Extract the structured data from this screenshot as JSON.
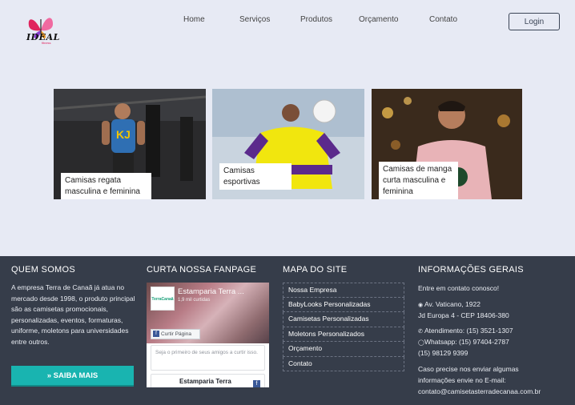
{
  "header": {
    "logo_text": "IDEAL",
    "logo_sub": "fitness",
    "nav": [
      "Home",
      "Serviços",
      "Produtos",
      "Orçamento",
      "Contato"
    ],
    "login_label": "Login"
  },
  "cards": [
    {
      "caption": "Camisas regata masculina e feminina"
    },
    {
      "caption": "Camisas esportivas"
    },
    {
      "caption": "Camisas de manga curta masculina e feminina"
    }
  ],
  "footer": {
    "about": {
      "title": "QUEM SOMOS",
      "text": "A empresa Terra de Canaã já atua no mercado desde 1998, o produto principal são as camisetas promocionais, personalizadas, eventos, formaturas, uniforme, moletons para universidades entre outros.",
      "button_label": "» SAIBA MAIS"
    },
    "fanpage": {
      "title": "CURTA NOSSA FANPAGE",
      "page_name": "Estamparia Terra ...",
      "likes": "1,9 mil curtidas",
      "like_button": "Curtir Página",
      "avatar_text": "TerraCanaã",
      "post_text": "Seja o primeiro de seus amigos a curtir isso.",
      "post2_name": "Estamparia Terra"
    },
    "sitemap": {
      "title": "MAPA DO SITE",
      "items": [
        "Nossa Empresa",
        "BabyLooks Personalizadas",
        "Camisetas Personalizadas",
        "Moletons Personalizados",
        "Orçamento",
        "Contato"
      ]
    },
    "info": {
      "title": "INFORMAÇÕES GERAIS",
      "intro": "Entre em contato conosco!",
      "address1": "Av. Vaticano, 1922",
      "address2": "Jd Europa 4 - CEP 18406-380",
      "phone": "Atendimento: (15) 3521-1307",
      "whatsapp": "Whatsapp: (15) 97404-2787",
      "phone2": "(15) 98129 9399",
      "email_note1": "Caso precise nos enviar algumas",
      "email_note2": "informações envie no E-mail:",
      "email": "contato@camisetasterradecanaa.com.br"
    }
  }
}
